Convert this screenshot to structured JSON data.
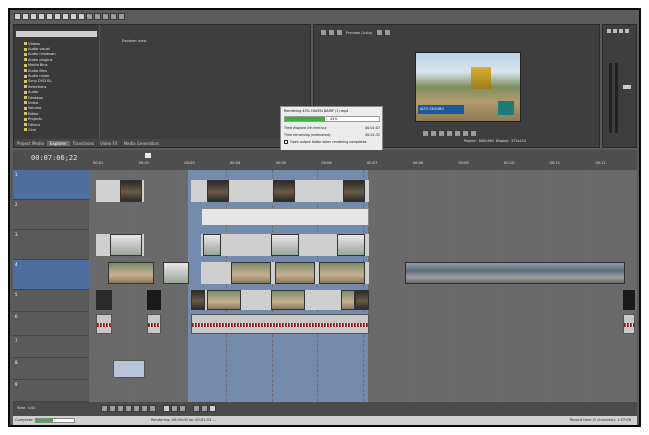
{
  "explorer": {
    "tree_items": [
      "Vídeos",
      "Audio visual",
      "Audio mixdown",
      "Audio plugins",
      "Media Bins",
      "Audio Bins",
      "Audio mixer",
      "Sony DVD BL",
      "Selections",
      "Audio",
      "Desktop",
      "Video",
      "Volume",
      "Editor",
      "Projects",
      "Others",
      "Cine"
    ],
    "files_header": "Explorer view",
    "tabs": [
      "Project Media",
      "Explorer",
      "Transitions",
      "Video FX",
      "Media Generators"
    ]
  },
  "preview": {
    "toolbar_label": "Preview (Auto)",
    "overlay_text": "ALTO SEGURO",
    "project_label": "Project:",
    "project_value": "640x360",
    "display_label": "Display:",
    "display_value": "373x210"
  },
  "render_dialog": {
    "title": "Rendering 43% HAVEN DAIRY (1).mp4",
    "progress_pct": 43,
    "progress_text": "43%",
    "elapsed_label": "Time elapsed (hh:mm:ss):",
    "elapsed_value": "00:01:07",
    "remaining_label": "Time remaining (estimated):",
    "remaining_value": "00:01:32",
    "checkbox_label": "Open output folder when rendering completes",
    "buttons": [
      "Open",
      "Open Folder",
      "Cancel"
    ]
  },
  "timeline": {
    "timecode": "00:07:06;22",
    "ruler_marks": [
      "00:01",
      "00:02",
      "00:03",
      "00:04",
      "00:05",
      "00:06",
      "00:07",
      "00:08",
      "00:09",
      "00:10",
      "00:11",
      "00:12"
    ],
    "rate_label": "Rate: 0.00"
  },
  "status": {
    "left": "Complete: 45 %",
    "middle": "Rendering: 00:00:00 for 00:01:03 ...",
    "right": "Record time (2 channels): 1:57:06"
  },
  "colors": {
    "app_bg": "#5b5b5b",
    "selection": "#7690b8",
    "waveform": "#b22222",
    "progress": "#3cb043"
  }
}
